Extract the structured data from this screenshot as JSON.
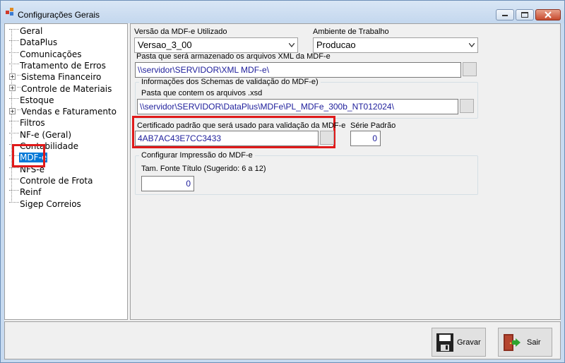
{
  "window": {
    "title": "Configurações Gerais"
  },
  "tree": {
    "items": [
      {
        "label": "Geral",
        "expandable": false
      },
      {
        "label": "DataPlus",
        "expandable": false
      },
      {
        "label": "Comunicações",
        "expandable": false
      },
      {
        "label": "Tratamento de Erros",
        "expandable": false
      },
      {
        "label": "Sistema Financeiro",
        "expandable": true
      },
      {
        "label": "Controle de Materiais",
        "expandable": true
      },
      {
        "label": "Estoque",
        "expandable": false
      },
      {
        "label": "Vendas e Faturamento",
        "expandable": true
      },
      {
        "label": "Filtros",
        "expandable": false
      },
      {
        "label": "NF-e (Geral)",
        "expandable": false
      },
      {
        "label": "Contabilidade",
        "expandable": false
      },
      {
        "label": "MDF-e",
        "expandable": false,
        "selected": true
      },
      {
        "label": "NFS-e",
        "expandable": false
      },
      {
        "label": "Controle de Frota",
        "expandable": false
      },
      {
        "label": "Reinf",
        "expandable": false
      },
      {
        "label": "Sigep Correios",
        "expandable": false
      }
    ]
  },
  "form": {
    "versao_label": "Versão da MDF-e Utilizado",
    "versao_value": "Versao_3_00",
    "ambiente_label": "Ambiente de Trabalho",
    "ambiente_value": "Producao",
    "pasta_xml_label": "Pasta que será armazenado os arquivos XML da MDF-e",
    "pasta_xml_value": "\\\\servidor\\SERVIDOR\\XML MDF-e\\",
    "schemas_group_title": "Informações dos Schemas de validação do MDF-e)",
    "schemas_label": "Pasta que contem os arquivos .xsd",
    "schemas_value": "\\\\servidor\\SERVIDOR\\DataPlus\\MDFe\\PL_MDFe_300b_NT012024\\",
    "certificado_label": "Certificado padrão que será usado para validação da MDF-e",
    "certificado_value": "4AB7AC43E7CC3433",
    "serie_label": "Série Padrão",
    "serie_value": "0",
    "impressao_group_title": "Configurar Impressão do MDF-e",
    "fonte_label": "Tam. Fonte Título (Sugerido: 6 a 12)",
    "fonte_value": "0"
  },
  "buttons": {
    "gravar": "Gravar",
    "sair": "Sair"
  },
  "colors": {
    "highlight": "#e01a1a",
    "selection": "#0078d7",
    "path_text": "#1d1d9b"
  },
  "icons": {
    "window": "app-icon",
    "gravar": "floppy-disk-icon",
    "sair": "exit-door-icon"
  }
}
